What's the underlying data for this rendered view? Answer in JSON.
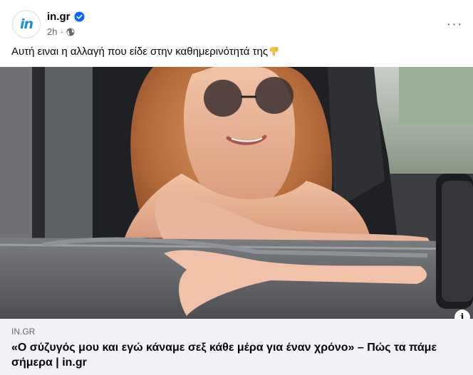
{
  "post": {
    "page_name": "in.gr",
    "avatar_text": "in",
    "time": "2h",
    "meta_separator": "·",
    "more_label": "···",
    "caption": "Αυτή ειναι η αλλαγή που είδε στην καθημερινότητά της"
  },
  "link_preview": {
    "domain": "IN.GR",
    "title": "«Ο σύζυγός μου και εγώ κάναμε σεξ κάθε μέρα για έναν χρόνο» – Πώς τα πάμε σήμερα | in.gr",
    "info_label": "i"
  },
  "icons": {
    "verified": "verified-badge-icon",
    "audience": "globe-icon",
    "caption_emoji": "pointing-down-hand-icon",
    "more": "more-horizontal-icon"
  },
  "colors": {
    "brand_blue": "#1a8fd6",
    "verified_blue": "#0866ff",
    "secondary_text": "#65676b",
    "preview_bg": "#f0f2f5"
  }
}
